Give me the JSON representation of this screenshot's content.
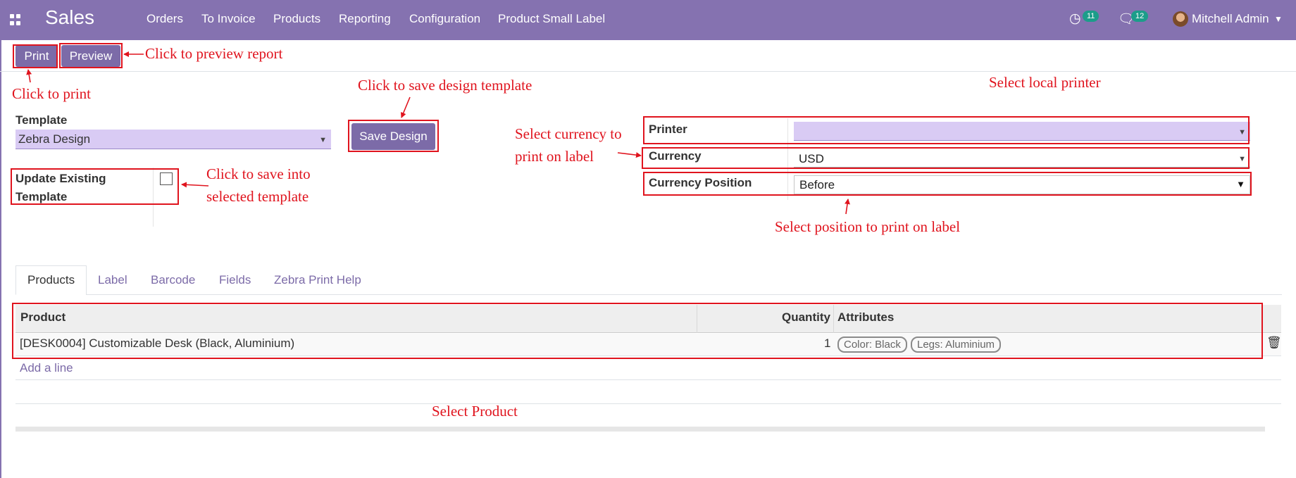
{
  "navbar": {
    "brand": "Sales",
    "menu": [
      "Orders",
      "To Invoice",
      "Products",
      "Reporting",
      "Configuration",
      "Product Small Label"
    ],
    "activity_count": "11",
    "message_count": "12",
    "user": "Mitchell Admin"
  },
  "toolbar": {
    "print_label": "Print",
    "preview_label": "Preview"
  },
  "form": {
    "template_label": "Template",
    "template_value": "Zebra Design",
    "save_design_label": "Save Design",
    "update_existing_label": "Update Existing Template",
    "update_existing_checked": false,
    "printer_label": "Printer",
    "printer_value": "",
    "currency_label": "Currency",
    "currency_value": "USD",
    "currency_position_label": "Currency Position",
    "currency_position_value": "Before"
  },
  "tabs": [
    "Products",
    "Label",
    "Barcode",
    "Fields",
    "Zebra Print Help"
  ],
  "table": {
    "headers": {
      "product": "Product",
      "quantity": "Quantity",
      "attributes": "Attributes"
    },
    "rows": [
      {
        "product": "[DESK0004] Customizable Desk (Black, Aluminium)",
        "quantity": "1",
        "attributes": [
          "Color: Black",
          "Legs: Aluminium"
        ]
      }
    ],
    "add_line": "Add a line"
  },
  "annotations": {
    "preview": "Click to preview report",
    "print": "Click to print",
    "save_design": "Click to save design template",
    "local_printer": "Select local printer",
    "currency_line1": "Select currency to",
    "currency_line2": "print on label",
    "save_into_line1": "Click to save into",
    "save_into_line2": "selected template",
    "position": "Select position to print on label",
    "product": "Select Product"
  },
  "colors": {
    "navbar": "#8572b0",
    "button": "#7c6ba8",
    "annotation": "#e0141e",
    "badge": "#1c9d8a"
  }
}
